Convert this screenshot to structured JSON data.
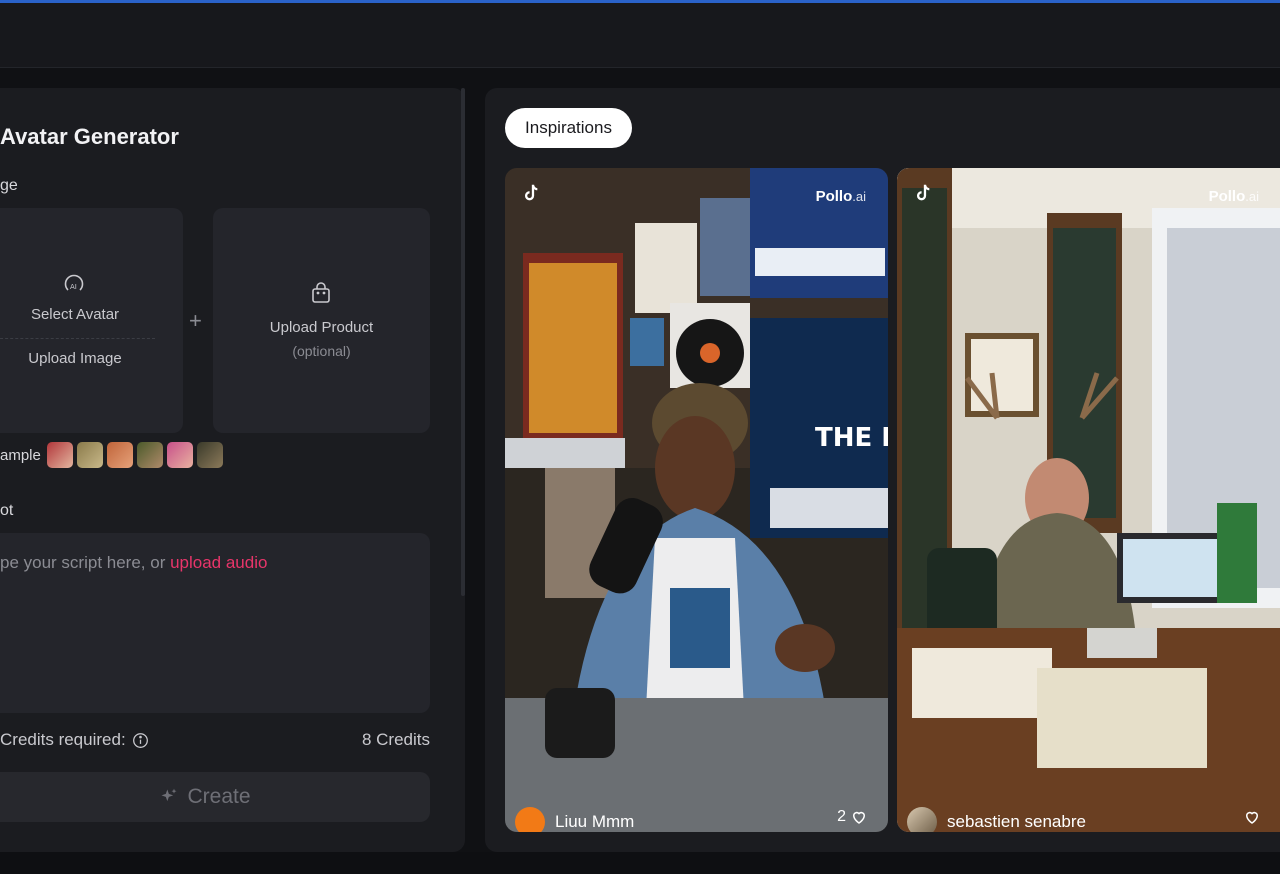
{
  "generator": {
    "title": "Avatar Generator",
    "image_section_label": "ge",
    "select_avatar": "Select Avatar",
    "upload_image": "Upload Image",
    "upload_product": "Upload Product",
    "upload_product_hint": "(optional)",
    "sample_label": "ample",
    "script_section_label": "ot",
    "script_placeholder": "pe your script here, or ",
    "upload_audio_link": "upload audio",
    "credits_required_label": "Credits required:",
    "credits_value": "8 Credits",
    "create_button": "Create"
  },
  "inspirations": {
    "tab_label": "Inspirations",
    "cards": [
      {
        "watermark": "Pollo",
        "watermark_suffix": ".ai",
        "user": "Liuu Mmm",
        "likes": "2"
      },
      {
        "watermark": "Pollo",
        "watermark_suffix": ".ai",
        "user": "sebastien senabre",
        "likes": ""
      }
    ]
  },
  "icons": {
    "avatar": "avatar-ai-icon",
    "product": "shopping-bag-icon",
    "info": "info-icon",
    "sparkle": "sparkle-icon",
    "tiktok": "tiktok-icon",
    "heart": "heart-icon"
  },
  "colors": {
    "accent_link": "#e8356a",
    "panel_bg": "#1b1c20",
    "page_bg": "#101114"
  }
}
